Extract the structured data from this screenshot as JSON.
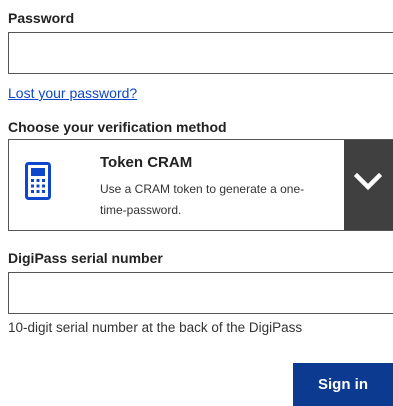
{
  "password": {
    "label": "Password",
    "value": "",
    "placeholder": ""
  },
  "lost_password_link": "Lost your password?",
  "verification": {
    "label": "Choose your verification method",
    "selected": {
      "title": "Token CRAM",
      "description": "Use a CRAM token to generate a one-time-password.",
      "icon": "calculator-token-icon"
    },
    "toggle_icon": "chevron-down-icon"
  },
  "digipass": {
    "label": "DigiPass serial number",
    "value": "",
    "placeholder": "",
    "helper": "10-digit serial number at the back of the DigiPass"
  },
  "signin_label": "Sign in",
  "colors": {
    "link": "#0e47cb",
    "primary_button": "#0c3a91",
    "toggle_background": "#404040",
    "token_icon": "#0e47cb",
    "border": "#555555"
  }
}
